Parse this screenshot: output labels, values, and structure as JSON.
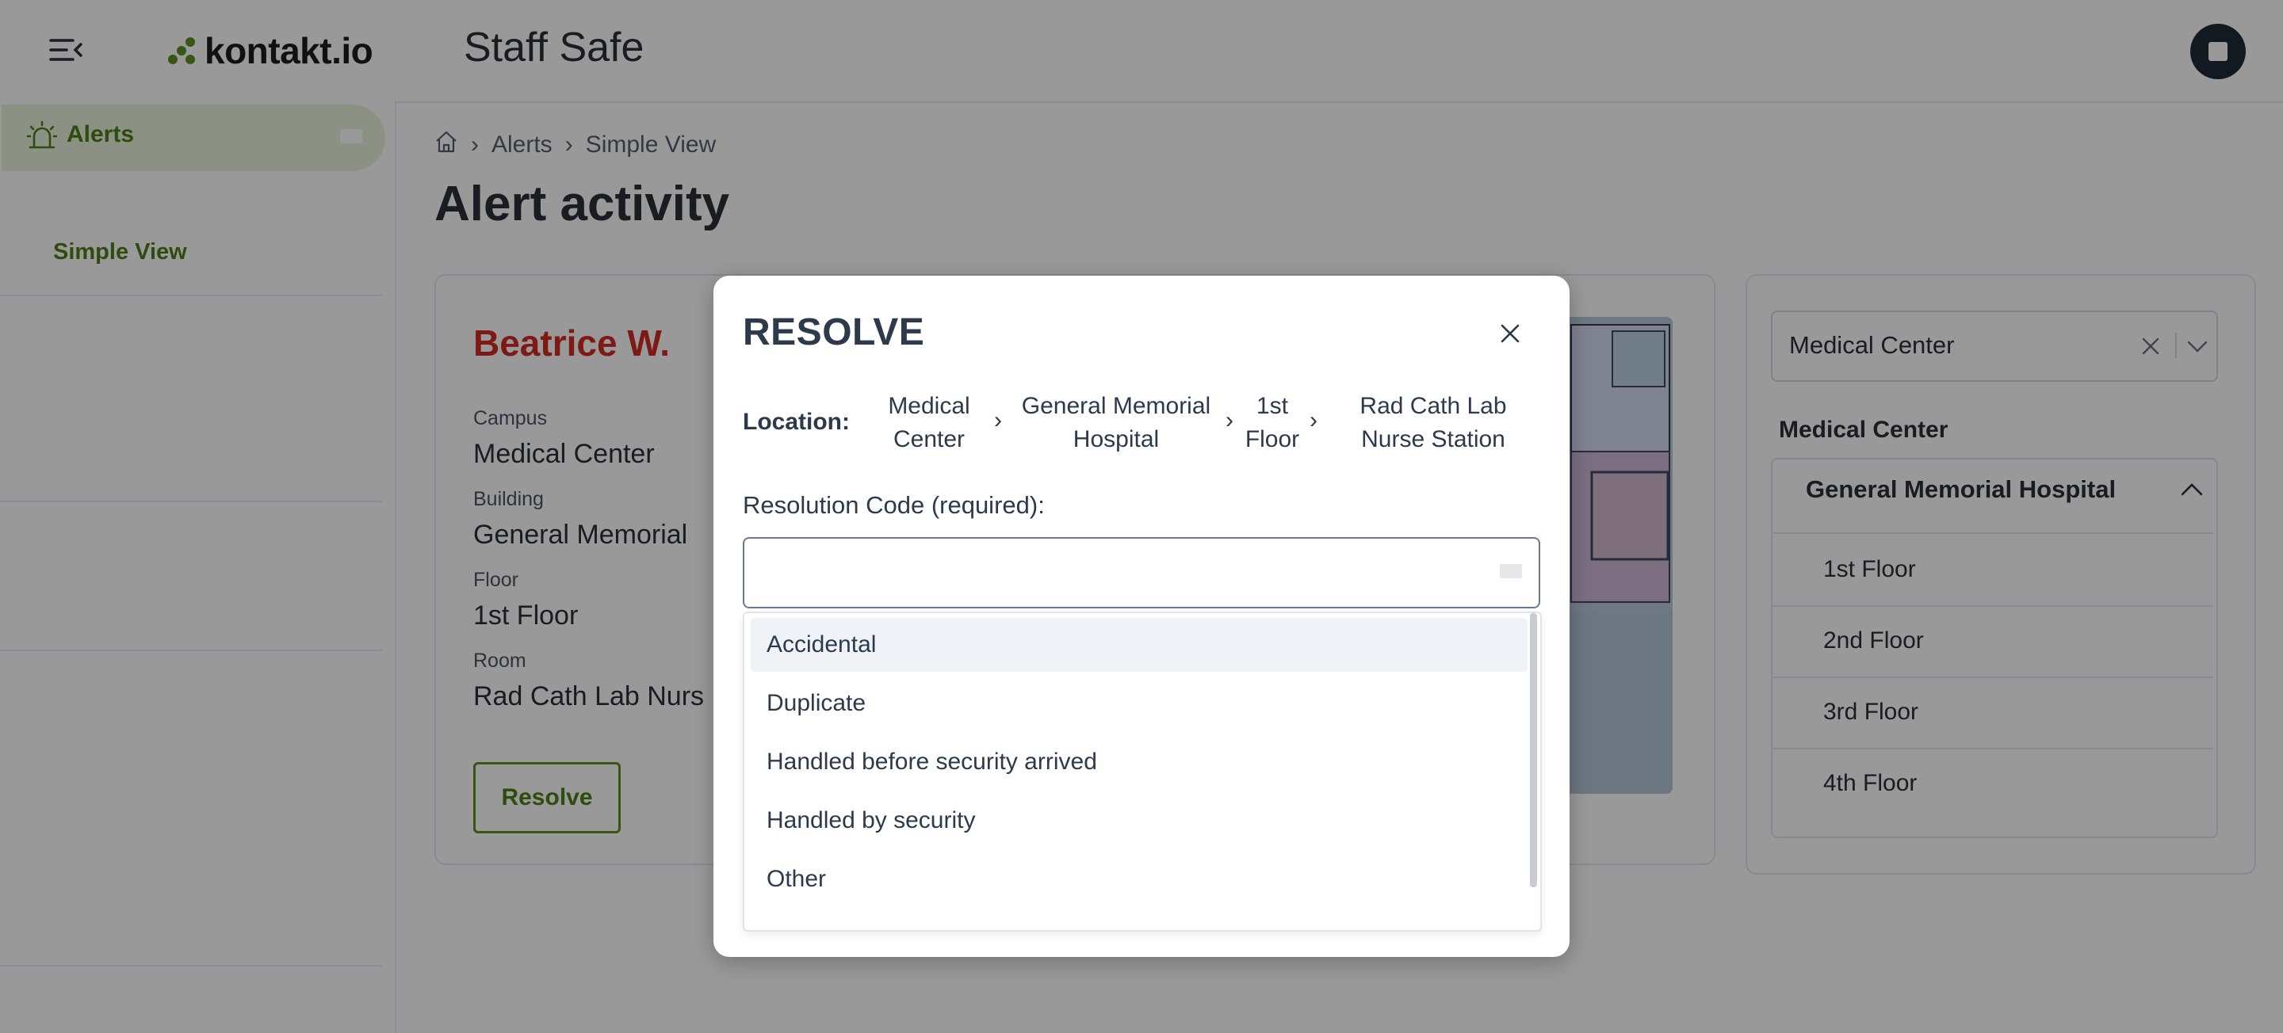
{
  "header": {
    "logo_text": "kontakt.io",
    "app_title": "Staff Safe"
  },
  "sidebar": {
    "alerts_label": "Alerts",
    "simple_view_label": "Simple View"
  },
  "breadcrumb": [
    "Alerts",
    "Simple View"
  ],
  "page_title": "Alert activity",
  "alert_card": {
    "person": "Beatrice W.",
    "fields": [
      {
        "label": "Campus",
        "value": "Medical Center"
      },
      {
        "label": "Building",
        "value": "General Memorial"
      },
      {
        "label": "Floor",
        "value": "1st Floor"
      },
      {
        "label": "Room",
        "value": "Rad Cath Lab Nurs"
      }
    ],
    "resolve_button": "Resolve"
  },
  "location_panel": {
    "select_value": "Medical Center",
    "tree_heading": "Medical Center",
    "group": "General Memorial Hospital",
    "floors": [
      "1st Floor",
      "2nd Floor",
      "3rd Floor",
      "4th Floor"
    ]
  },
  "modal": {
    "title": "RESOLVE",
    "location_label": "Location:",
    "location_path": [
      "Medical Center",
      "General Memorial Hospital",
      "1st Floor",
      "Rad Cath Lab Nurse Station"
    ],
    "location_separator": "›",
    "resolution_label": "Resolution Code (required):",
    "options": [
      "Accidental",
      "Duplicate",
      "Handled before security arrived",
      "Handled by security",
      "Other"
    ],
    "highlighted_option": "Accidental"
  },
  "colors": {
    "brand_green": "#4f7f1a",
    "alert_red": "#d42a22",
    "text_dark": "#2c3a4b"
  }
}
